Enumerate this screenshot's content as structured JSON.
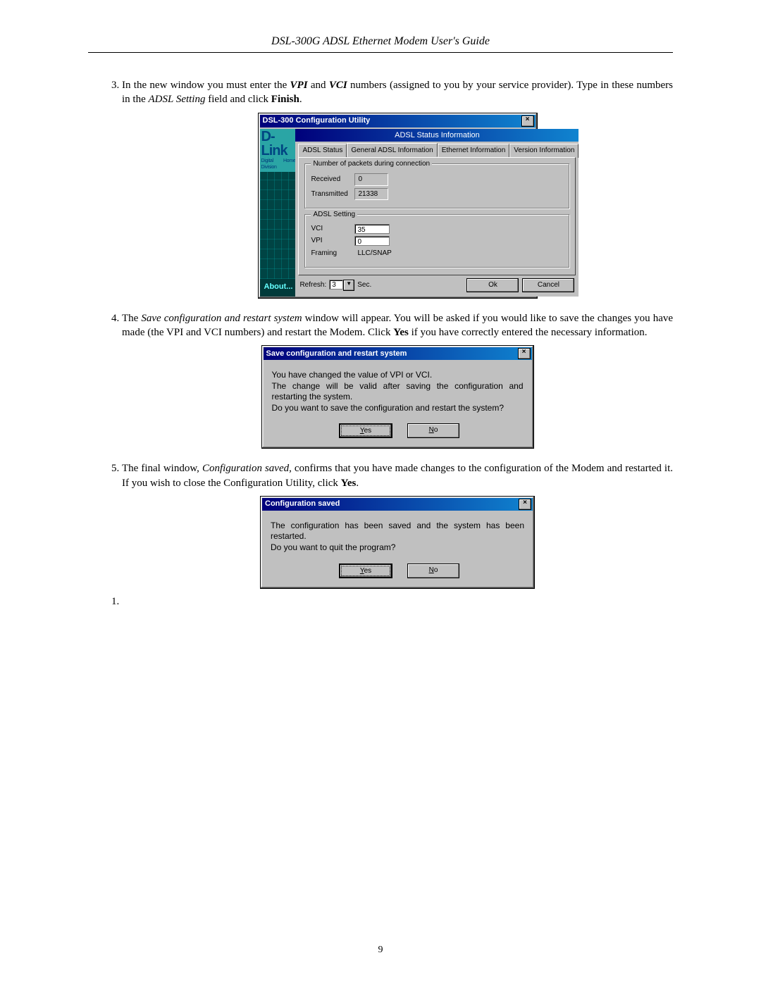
{
  "header": {
    "title": "DSL-300G ADSL Ethernet Modem User's Guide"
  },
  "steps": {
    "s3": {
      "num": "3.",
      "p1_a": "In the new window you must enter the ",
      "p1_b": "VPI",
      "p1_c": " and ",
      "p1_d": "VCI",
      "p1_e": " numbers (assigned to you by your service provider). Type in these numbers in the ",
      "p1_f": "ADSL Setting",
      "p1_g": " field and click ",
      "p1_h": "Finish",
      "p1_i": "."
    },
    "s4": {
      "num": "4.",
      "p_a": "The ",
      "p_b": "Save configuration and restart system",
      "p_c": " window will appear. You will be asked if you would like to save the changes you have made (the VPI and VCI numbers) and restart the Modem. Click ",
      "p_d": "Yes",
      "p_e": " if you have correctly entered the necessary information."
    },
    "s5": {
      "num": "5.",
      "p_a": "The final window, ",
      "p_b": "Configuration saved",
      "p_c": ", confirms that you have made changes to the configuration of the Modem and restarted it. If you wish to close the Configuration Utility, click ",
      "p_d": "Yes",
      "p_e": "."
    }
  },
  "config_win": {
    "title": "DSL-300 Configuration Utility",
    "brand": "D-Link",
    "brand_sub": "Digital Home Division",
    "about": "About...",
    "header_strip": "ADSL Status Information",
    "tabs": [
      "ADSL Status",
      "General ADSL Information",
      "Ethernet Information",
      "Version Information"
    ],
    "grp1_title": "Number of packets during connection",
    "received_label": "Received",
    "received_value": "0",
    "transmitted_label": "Transmitted",
    "transmitted_value": "21338",
    "grp2_title": "ADSL Setting",
    "vci_label": "VCI",
    "vci_value": "35",
    "vpi_label": "VPI",
    "vpi_value": "0",
    "framing_label": "Framing",
    "framing_value": "LLC/SNAP",
    "refresh_label": "Refresh:",
    "refresh_value": "3",
    "sec_label": "Sec.",
    "ok": "Ok",
    "cancel": "Cancel"
  },
  "dlg_save": {
    "title": "Save configuration and restart system",
    "line1": "You have changed the value of VPI or VCI.",
    "line2": "The change will be valid after saving the configuration and restarting the system.",
    "line3": "Do you want to save the configuration and restart the system?",
    "yes": "Yes",
    "no": "No"
  },
  "dlg_saved": {
    "title": "Configuration saved",
    "line1": "The configuration has been saved and the system has been restarted.",
    "line2": "Do you want to quit the program?",
    "yes": "Yes",
    "no": "No"
  },
  "page_number": "9"
}
